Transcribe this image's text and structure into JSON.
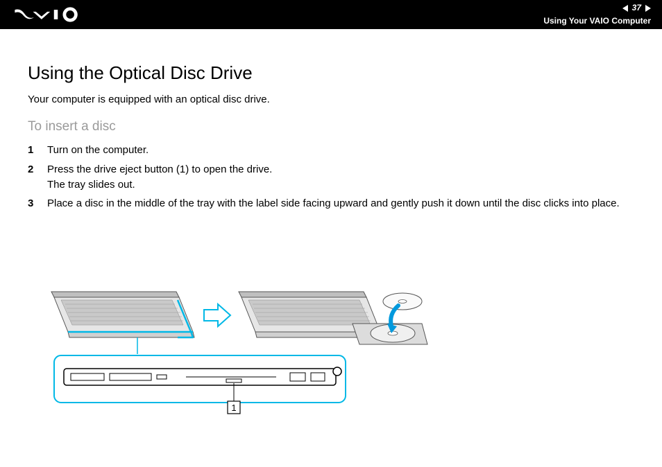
{
  "header": {
    "page_number": "37",
    "section": "Using Your VAIO Computer"
  },
  "title": "Using the Optical Disc Drive",
  "intro": "Your computer is equipped with an optical disc drive.",
  "subhead": "To insert a disc",
  "steps": [
    {
      "text": "Turn on the computer."
    },
    {
      "text": "Press the drive eject button (1) to open the drive.",
      "text2": "The tray slides out."
    },
    {
      "text": "Place a disc in the middle of the tray with the label side facing upward and gently push it down until the disc clicks into place."
    }
  ],
  "figure": {
    "callout_label": "1"
  }
}
